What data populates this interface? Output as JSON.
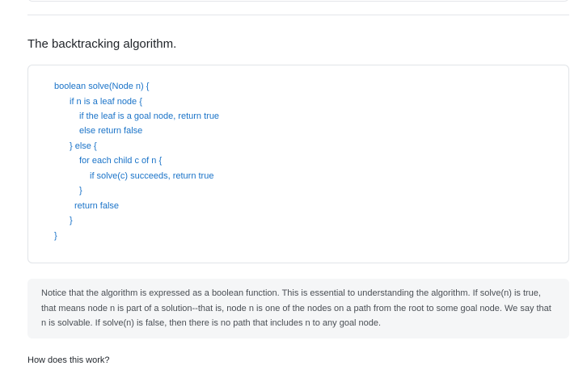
{
  "heading": "The backtracking algorithm.",
  "code_lines": [
    "boolean solve(Node n) {",
    "if n is a leaf node {",
    "if the leaf is a goal node, return true",
    "else return false",
    "} else {",
    "for each child c of n {",
    "if solve(c) succeeds, return true",
    "}",
    "return false",
    "}",
    "}"
  ],
  "note": "Notice that the algorithm is expressed as a boolean function. This is essential to understanding the algorithm. If solve(n) is true, that means node n is part of a solution--that is, node n is one of the nodes on a path from the root to some goal node. We say that n is solvable. If solve(n) is false, then there is no path that includes n to any goal node.",
  "question": "How does this work?",
  "colors": {
    "code": "#1a73c8",
    "note_background": "#f5f6f7",
    "border": "#e1e4e8"
  }
}
